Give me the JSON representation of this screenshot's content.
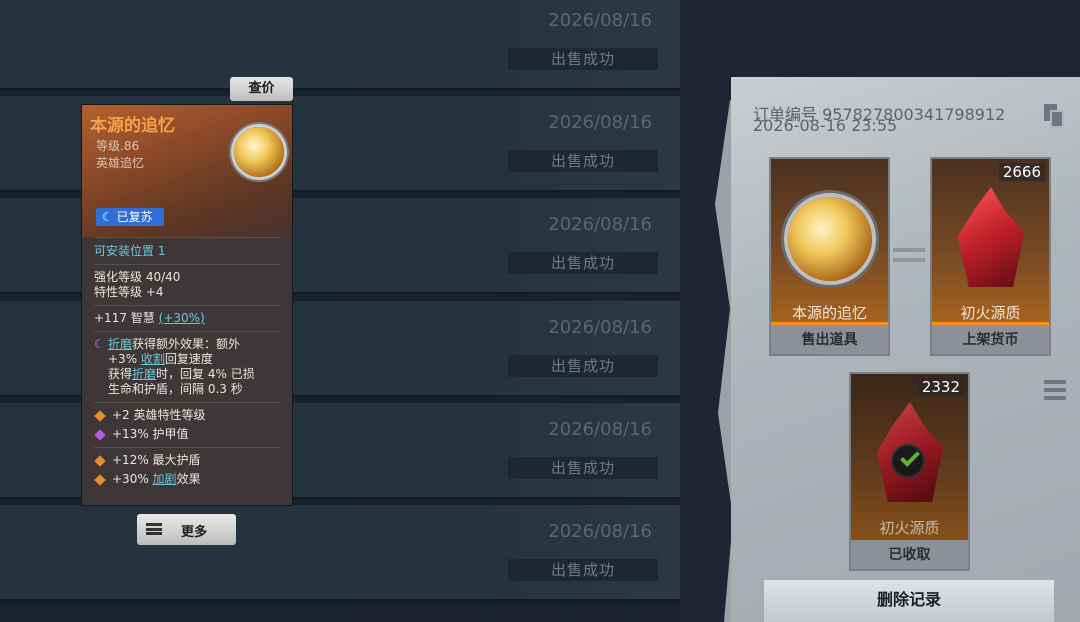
{
  "records": [
    {
      "date": "2026/08/16",
      "status": "出售成功"
    },
    {
      "date": "2026/08/16",
      "status": "出售成功"
    },
    {
      "date": "2026/08/16",
      "status": "出售成功"
    },
    {
      "date": "2026/08/16",
      "status": "出售成功"
    },
    {
      "date": "2026/08/16",
      "status": "出售成功"
    },
    {
      "date": "2026/08/16",
      "status": "出售成功"
    }
  ],
  "tooltip": {
    "price_check_label": "查价",
    "item_name": "本源的追忆",
    "level": "等级.86",
    "type": "英雄追忆",
    "revived_badge": "☾ 已复苏",
    "install_slots": "可安装位置 1",
    "enhance_level": "强化等级 40/40",
    "trait_level": "特性等级 +4",
    "wisdom_prefix": "+117 智慧 ",
    "wisdom_bonus": "(+30%)",
    "effect": {
      "kw1": "折磨",
      "t1": "获得额外效果：额外",
      "t2": "+3% ",
      "kw2": "收割",
      "t3": "回复速度",
      "t4": "获得",
      "kw3": "折磨",
      "t5": "时，回复 4% 已损",
      "t6": "生命和护盾，间隔 0.3 秒"
    },
    "affixes": [
      {
        "text": "+2 英雄特性等级",
        "color": "#e0902e"
      },
      {
        "text": "+13% 护甲值",
        "color": "#b35ee0"
      }
    ],
    "affixes2": [
      {
        "text": "+12% 最大护盾",
        "color": "#e0902e"
      }
    ],
    "last_affix": {
      "prefix": "+30% ",
      "link": "加剧",
      "suffix": "效果",
      "color": "#e0902e"
    },
    "more_label": "更多"
  },
  "detail": {
    "order_no": "订单编号 957827800341798912",
    "order_time": "2026-08-16 23:55",
    "sold_item": {
      "name": "本源的追忆",
      "label": "售出道具"
    },
    "currency": {
      "name": "初火源质",
      "label": "上架货币",
      "count": "2666"
    },
    "received": {
      "name": "初火源质",
      "label": "已收取",
      "count": "2332"
    },
    "delete_label": "删除记录"
  }
}
